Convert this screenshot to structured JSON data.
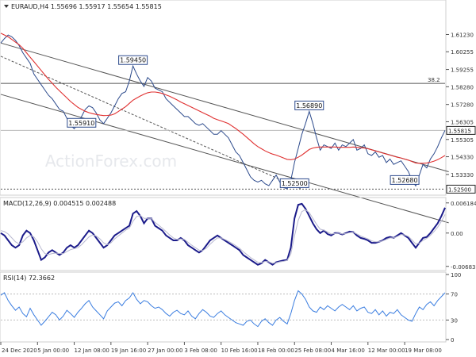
{
  "chart_data": [
    {
      "type": "line",
      "title": "EURAUD,H4  1.55696 1.55917 1.55654 1.55815",
      "ylim": [
        1.5225,
        1.6255
      ],
      "y_ticks": [
        "1.61230",
        "1.60255",
        "1.59255",
        "1.58280",
        "1.57280",
        "1.56305",
        "1.55305",
        "1.54330",
        "1.53330"
      ],
      "y_tick_values": [
        1.6123,
        1.60255,
        1.59255,
        1.5828,
        1.5728,
        1.56305,
        1.55305,
        1.5433,
        1.5333
      ],
      "last_price_label": "1.55815",
      "last_price": 1.55815,
      "low_marker_label": "1.52500",
      "low_marker_value": 1.525,
      "fib_label": "38.2",
      "fib_value": 1.5847,
      "watermark": "ActionForex.com",
      "annotations": [
        {
          "text": "1.59450",
          "x": 36,
          "y": 1.5945
        },
        {
          "text": "1.55910",
          "x": 22,
          "y": 1.5591
        },
        {
          "text": "1.56890",
          "x": 84,
          "y": 1.5689
        },
        {
          "text": "1.52500",
          "x": 80,
          "y": 1.525
        },
        {
          "text": "1.52680",
          "x": 110,
          "y": 1.5268
        }
      ],
      "channel_lines": [
        {
          "x": [
            0,
            122
          ],
          "y": [
            1.6075,
            1.5348
          ],
          "style": "solid"
        },
        {
          "x": [
            0,
            122
          ],
          "y": [
            1.5785,
            1.506
          ],
          "style": "solid"
        },
        {
          "x": [
            0,
            82
          ],
          "y": [
            1.6,
            1.525
          ],
          "style": "dashed"
        }
      ],
      "x_ticks": [
        "24 Dec 2020",
        "5 Jan 00:00",
        "12 Jan 08:00",
        "19 Jan 16:00",
        "27 Jan 00:00",
        "3 Feb 08:00",
        "10 Feb 16:00",
        "18 Feb 00:00",
        "25 Feb 08:00",
        "4 Mar 16:00",
        "12 Mar 00:00",
        "19 Mar 08:00"
      ],
      "x_tick_index": [
        0,
        10,
        20,
        30,
        40,
        50,
        60,
        70,
        80,
        90,
        100,
        110
      ],
      "x_count": 122,
      "series": [
        {
          "name": "EURAUD",
          "color": "#2c4a8c",
          "values": [
            1.6075,
            1.61,
            1.612,
            1.611,
            1.609,
            1.606,
            1.602,
            1.599,
            1.596,
            1.59,
            1.587,
            1.584,
            1.581,
            1.578,
            1.576,
            1.573,
            1.57,
            1.569,
            1.565,
            1.561,
            1.5591,
            1.562,
            1.566,
            1.57,
            1.572,
            1.571,
            1.568,
            1.564,
            1.562,
            1.565,
            1.568,
            1.572,
            1.576,
            1.579,
            1.58,
            1.586,
            1.5945,
            1.59,
            1.586,
            1.583,
            1.588,
            1.586,
            1.582,
            1.581,
            1.58,
            1.576,
            1.574,
            1.572,
            1.57,
            1.568,
            1.566,
            1.566,
            1.564,
            1.562,
            1.561,
            1.562,
            1.56,
            1.558,
            1.556,
            1.556,
            1.558,
            1.556,
            1.554,
            1.55,
            1.546,
            1.544,
            1.54,
            1.536,
            1.532,
            1.53,
            1.529,
            1.53,
            1.528,
            1.527,
            1.53,
            1.533,
            1.529,
            1.526,
            1.5252,
            1.53,
            1.54,
            1.548,
            1.556,
            1.562,
            1.5689,
            1.562,
            1.554,
            1.547,
            1.55,
            1.549,
            1.548,
            1.551,
            1.547,
            1.55,
            1.549,
            1.551,
            1.553,
            1.547,
            1.548,
            1.55,
            1.545,
            1.544,
            1.546,
            1.543,
            1.544,
            1.54,
            1.542,
            1.539,
            1.54,
            1.541,
            1.538,
            1.535,
            1.53,
            1.5268,
            1.533,
            1.539,
            1.537,
            1.542,
            1.545,
            1.549,
            1.554,
            1.5582
          ]
        },
        {
          "name": "MA",
          "color": "#e03030",
          "values": [
            1.613,
            1.612,
            1.611,
            1.6095,
            1.608,
            1.6065,
            1.6045,
            1.602,
            1.5995,
            1.597,
            1.5945,
            1.592,
            1.5895,
            1.587,
            1.5848,
            1.5825,
            1.5805,
            1.5785,
            1.5765,
            1.5745,
            1.5728,
            1.5712,
            1.57,
            1.569,
            1.5682,
            1.5676,
            1.5672,
            1.5668,
            1.5665,
            1.5666,
            1.5668,
            1.5675,
            1.5688,
            1.5702,
            1.5716,
            1.5734,
            1.5752,
            1.5764,
            1.5776,
            1.5786,
            1.5794,
            1.5798,
            1.5798,
            1.5795,
            1.579,
            1.5782,
            1.5774,
            1.5764,
            1.5754,
            1.5742,
            1.5732,
            1.5722,
            1.5712,
            1.5702,
            1.5692,
            1.5682,
            1.5672,
            1.5662,
            1.565,
            1.5642,
            1.5635,
            1.5628,
            1.562,
            1.5606,
            1.5592,
            1.5576,
            1.556,
            1.5542,
            1.5524,
            1.5506,
            1.549,
            1.5478,
            1.5466,
            1.5456,
            1.5448,
            1.5442,
            1.5434,
            1.5426,
            1.5418,
            1.5416,
            1.542,
            1.543,
            1.5442,
            1.5458,
            1.5474,
            1.5482,
            1.5486,
            1.5488,
            1.5488,
            1.5488,
            1.5488,
            1.5488,
            1.5486,
            1.5486,
            1.5486,
            1.5486,
            1.5488,
            1.5486,
            1.5484,
            1.5482,
            1.5478,
            1.5472,
            1.5466,
            1.546,
            1.5454,
            1.5448,
            1.5442,
            1.5436,
            1.543,
            1.5426,
            1.542,
            1.5414,
            1.5406,
            1.5398,
            1.5396,
            1.5396,
            1.5398,
            1.5402,
            1.5408,
            1.5416,
            1.5428,
            1.544
          ]
        }
      ]
    },
    {
      "type": "line",
      "title": "MACD(12,26,9) 0.004515 0.002488",
      "ylim": [
        -0.0072,
        0.0068
      ],
      "y_ticks": [
        "0.006184",
        "0.00",
        "-0.006837"
      ],
      "y_tick_values": [
        0.006184,
        0.0,
        -0.006837
      ],
      "x_count": 122,
      "series": [
        {
          "name": "MACD",
          "color": "#1b1b8a",
          "values": [
            0.0,
            -0.0005,
            -0.0015,
            -0.0025,
            -0.003,
            -0.0025,
            -0.0005,
            0.0005,
            0.0,
            -0.0015,
            -0.0035,
            -0.0055,
            -0.005,
            -0.004,
            -0.0035,
            -0.004,
            -0.0045,
            -0.004,
            -0.003,
            -0.0025,
            -0.003,
            -0.0025,
            -0.0015,
            -0.0005,
            0.0005,
            0.0,
            -0.001,
            -0.002,
            -0.003,
            -0.0025,
            -0.0015,
            -0.0005,
            0.0,
            0.0005,
            0.001,
            0.0015,
            0.004,
            0.0045,
            0.0035,
            0.002,
            0.003,
            0.003,
            0.0015,
            0.001,
            0.0005,
            -0.0005,
            -0.001,
            -0.0015,
            -0.0015,
            -0.001,
            -0.0015,
            -0.0025,
            -0.003,
            -0.0035,
            -0.004,
            -0.0035,
            -0.0025,
            -0.0015,
            -0.001,
            -0.0005,
            -0.001,
            -0.0015,
            -0.002,
            -0.0025,
            -0.003,
            -0.0035,
            -0.0045,
            -0.005,
            -0.0055,
            -0.006,
            -0.0065,
            -0.0062,
            -0.0055,
            -0.006,
            -0.0065,
            -0.006,
            -0.0058,
            -0.0056,
            -0.0055,
            -0.003,
            0.003,
            0.0058,
            0.006,
            0.005,
            0.0035,
            0.002,
            0.0008,
            0.0,
            0.0005,
            -0.0002,
            -0.0005,
            0.0,
            0.0,
            -0.0003,
            0.0,
            0.0003,
            0.0002,
            -0.0005,
            -0.001,
            -0.0012,
            -0.0015,
            -0.002,
            -0.002,
            -0.0018,
            -0.0015,
            -0.001,
            -0.0008,
            -0.001,
            -0.0005,
            0.0,
            -0.0005,
            -0.001,
            -0.002,
            -0.003,
            -0.002,
            -0.001,
            -0.0008,
            0.0,
            0.001,
            0.002,
            0.0035,
            0.0052
          ]
        },
        {
          "name": "Signal",
          "color": "#b8b8d0",
          "values": [
            0.0005,
            0.0003,
            -0.0002,
            -0.001,
            -0.0018,
            -0.0022,
            -0.0018,
            -0.001,
            -0.0005,
            -0.0008,
            -0.0018,
            -0.0032,
            -0.0042,
            -0.0044,
            -0.0042,
            -0.0041,
            -0.0042,
            -0.0042,
            -0.0038,
            -0.0034,
            -0.0032,
            -0.003,
            -0.0024,
            -0.0016,
            -0.0008,
            -0.0004,
            -0.0006,
            -0.0012,
            -0.002,
            -0.0024,
            -0.002,
            -0.0012,
            -0.0006,
            0.0,
            0.0006,
            0.001,
            0.0024,
            0.0034,
            0.0036,
            0.003,
            0.003,
            0.003,
            0.0022,
            0.0016,
            0.001,
            0.0003,
            -0.0004,
            -0.001,
            -0.0013,
            -0.0012,
            -0.0013,
            -0.0019,
            -0.0025,
            -0.003,
            -0.0035,
            -0.0036,
            -0.0031,
            -0.0023,
            -0.0016,
            -0.001,
            -0.001,
            -0.0013,
            -0.0017,
            -0.0021,
            -0.0026,
            -0.0031,
            -0.0038,
            -0.0044,
            -0.005,
            -0.0055,
            -0.006,
            -0.0061,
            -0.0058,
            -0.0059,
            -0.0062,
            -0.0061,
            -0.0059,
            -0.0058,
            -0.0056,
            -0.0043,
            -0.0006,
            0.0026,
            0.0044,
            0.0048,
            0.0042,
            0.003,
            0.0018,
            0.0008,
            0.0006,
            0.0002,
            -0.0002,
            -0.0001,
            0.0,
            -0.0002,
            -0.0001,
            0.0001,
            0.0002,
            -0.0002,
            -0.0006,
            -0.0009,
            -0.0012,
            -0.0016,
            -0.0018,
            -0.0018,
            -0.0016,
            -0.0013,
            -0.001,
            -0.001,
            -0.0007,
            -0.0003,
            -0.0004,
            -0.0007,
            -0.0014,
            -0.0022,
            -0.0021,
            -0.0015,
            -0.0011,
            -0.0005,
            0.0003,
            0.0012,
            0.0024,
            0.0038
          ]
        }
      ]
    },
    {
      "type": "line",
      "title": "RSI(14) 72.3662",
      "ylim": [
        0,
        100
      ],
      "y_ticks": [
        "100",
        "70",
        "30",
        "0"
      ],
      "y_tick_values": [
        100,
        70,
        30,
        0
      ],
      "levels": [
        70,
        30
      ],
      "x_count": 122,
      "series": [
        {
          "name": "RSI",
          "color": "#3a7de0",
          "values": [
            68,
            72,
            60,
            52,
            45,
            50,
            40,
            35,
            48,
            38,
            30,
            22,
            28,
            35,
            42,
            38,
            30,
            36,
            45,
            40,
            34,
            42,
            48,
            55,
            60,
            50,
            44,
            38,
            32,
            44,
            50,
            56,
            58,
            52,
            60,
            64,
            72,
            62,
            55,
            60,
            58,
            52,
            48,
            50,
            46,
            40,
            36,
            42,
            45,
            40,
            38,
            44,
            36,
            32,
            40,
            46,
            42,
            36,
            34,
            40,
            44,
            38,
            34,
            30,
            26,
            24,
            22,
            28,
            30,
            24,
            20,
            28,
            32,
            26,
            22,
            30,
            34,
            28,
            24,
            40,
            60,
            75,
            70,
            62,
            50,
            44,
            42,
            50,
            46,
            52,
            48,
            44,
            50,
            54,
            50,
            46,
            52,
            44,
            48,
            50,
            42,
            40,
            46,
            38,
            44,
            36,
            42,
            40,
            46,
            38,
            34,
            30,
            28,
            40,
            50,
            46,
            54,
            58,
            52,
            60,
            66,
            72
          ]
        }
      ]
    }
  ]
}
